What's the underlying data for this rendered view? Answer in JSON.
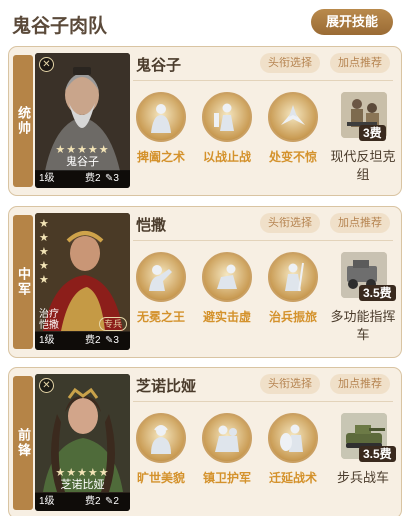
{
  "header": {
    "title": "鬼谷子肉队",
    "expand_label": "展开技能"
  },
  "pill_labels": {
    "title_select": "头衔选择",
    "points_recommend": "加点推荐"
  },
  "cards": [
    {
      "position": "统帅",
      "hero_name": "鬼谷子",
      "portrait": {
        "name": "鬼谷子",
        "stars": "★★★★★",
        "level": "1级",
        "cost": "费2",
        "troop": "3",
        "badge": "✕"
      },
      "skills": [
        "捭阖之术",
        "以战止战",
        "处变不惊"
      ],
      "item": {
        "cost": "3费",
        "name": "现代反坦克组"
      }
    },
    {
      "position": "中军",
      "hero_name": "恺撒",
      "portrait": {
        "name_line1": "治疗",
        "name_line2": "恺撒",
        "stars": "★★★★★",
        "level": "1级",
        "cost": "费2",
        "troop": "3",
        "tag": "专兵"
      },
      "skills": [
        "无冕之王",
        "避实击虚",
        "治兵振旅"
      ],
      "item": {
        "cost": "3.5费",
        "name": "多功能指挥车"
      }
    },
    {
      "position": "前锋",
      "hero_name": "芝诺比娅",
      "portrait": {
        "name": "芝诺比娅",
        "stars": "★★★★★",
        "level": "1级",
        "cost": "费2",
        "troop": "2",
        "badge": "✕"
      },
      "skills": [
        "旷世美貌",
        "镇卫护军",
        "迁延战术"
      ],
      "item": {
        "cost": "3.5费",
        "name": "步兵战车"
      }
    }
  ]
}
